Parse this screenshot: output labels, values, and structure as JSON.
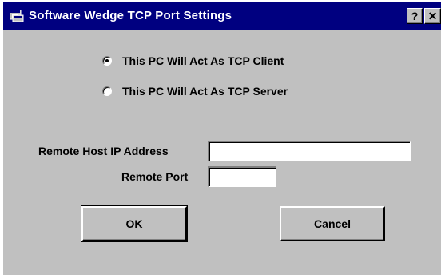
{
  "window": {
    "title": "Software Wedge TCP Port Settings",
    "help_glyph": "?",
    "close_glyph": "✕",
    "titlebar_color": "#000080",
    "face_color": "#c0c0c0"
  },
  "mode": {
    "options": [
      {
        "label": "This PC Will Act As TCP Client",
        "selected": true
      },
      {
        "label": "This PC Will Act As TCP Server",
        "selected": false
      }
    ]
  },
  "fields": {
    "remote_host_label": "Remote Host IP Address",
    "remote_host_value": "",
    "remote_port_label": "Remote Port",
    "remote_port_value": ""
  },
  "buttons": {
    "ok": {
      "mnemonic": "O",
      "rest": "K"
    },
    "cancel": {
      "mnemonic": "C",
      "rest": "ancel"
    }
  },
  "icons": {
    "app": "app-window-icon",
    "help": "help-icon",
    "close": "close-icon"
  }
}
